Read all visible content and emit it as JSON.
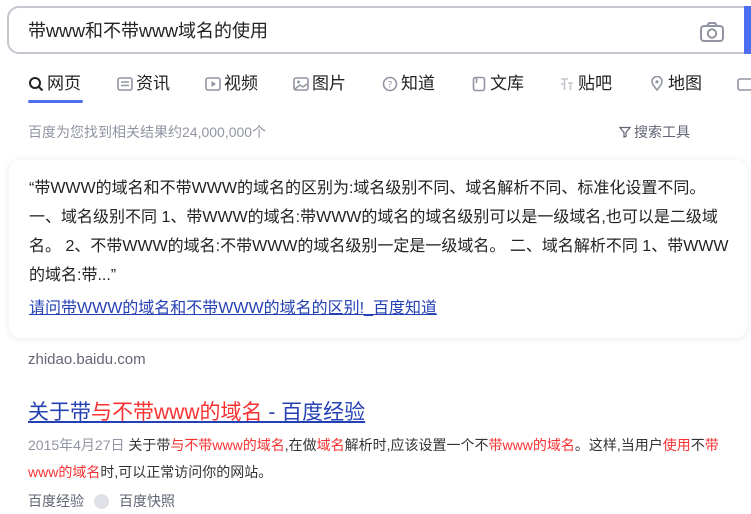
{
  "search": {
    "query": "带www和不带www域名的使用"
  },
  "tabs": [
    {
      "label": "网页",
      "icon": "search-icon"
    },
    {
      "label": "资讯",
      "icon": "news-icon"
    },
    {
      "label": "视频",
      "icon": "video-icon"
    },
    {
      "label": "图片",
      "icon": "image-icon"
    },
    {
      "label": "知道",
      "icon": "question-icon"
    },
    {
      "label": "文库",
      "icon": "doc-icon"
    },
    {
      "label": "贴吧",
      "icon": "tieba-icon"
    },
    {
      "label": "地图",
      "icon": "map-icon"
    }
  ],
  "results_meta": {
    "count_text": "百度为您找到相关结果约24,000,000个",
    "tools_label": "搜索工具"
  },
  "answer_card": {
    "text": "“带WWW的域名和不带WWW的域名的区别为:域名级别不同、域名解析不同、标准化设置不同。 一、域名级别不同 1、带WWW的域名:带WWW的域名的域名级别可以是一级域名,也可以是二级域名。 2、不带WWW的域名:不带WWW的域名级别一定是一级域名。 二、域名解析不同 1、带WWW的域名:带...”",
    "link_text": "请问带WWW的域名和不带WWW的域名的区别!_百度知道",
    "domain": "zhidao.baidu.com"
  },
  "result": {
    "title_prefix": "关于带",
    "title_em": "与不带www的域名",
    "title_suffix": " - 百度经验",
    "date": "2015年4月27日",
    "abs_1": " 关于带",
    "abs_em1": "与不带www的域名",
    "abs_2": ",在做",
    "abs_em2": "域名",
    "abs_3": "解析时,应该设置一个不",
    "abs_em3": "带www的域名",
    "abs_4": "。这样,当用户",
    "abs_em4": "使用",
    "abs_5": "不",
    "abs_em5": "带www的域名",
    "abs_6": "时,可以正常访问你的网站。",
    "source": "百度经验",
    "snapshot": "百度快照"
  },
  "colors": {
    "accent": "#4e6ef2",
    "link": "#2440b3",
    "highlight": "#f73131"
  }
}
